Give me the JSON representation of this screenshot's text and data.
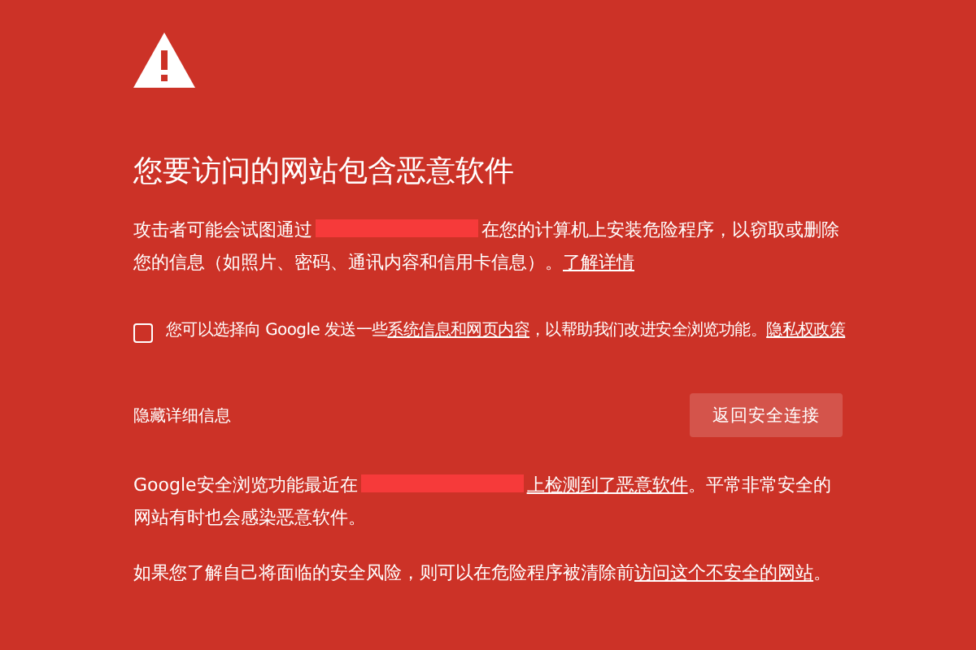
{
  "title": "您要访问的网站包含恶意软件",
  "intro": [
    {
      "kind": "text",
      "text": "攻击者可能会试图通过"
    },
    {
      "kind": "redacted"
    },
    {
      "kind": "text",
      "text": "在您的计算机上安装危险程序，以窃取或删除您的信息（如照片、密码、通讯内容和信用卡信息）。"
    },
    {
      "kind": "link",
      "text": "了解详情"
    }
  ],
  "report": {
    "checked": false,
    "parts": [
      {
        "kind": "text",
        "text": "您可以选择向 Google 发送一些"
      },
      {
        "kind": "link",
        "text": "系统信息和网页内容"
      },
      {
        "kind": "text",
        "text": "，以帮助我们改进安全浏览功能。"
      },
      {
        "kind": "link",
        "text": "隐私权政策"
      }
    ]
  },
  "details_toggle": "隐藏详细信息",
  "back_button": "返回安全连接",
  "details": [
    [
      {
        "kind": "text",
        "text": "Google安全浏览功能最近在"
      },
      {
        "kind": "redacted"
      },
      {
        "kind": "link",
        "text": "上检测到了恶意软件"
      },
      {
        "kind": "text",
        "text": "。平常非常安全的网站有时也会感染恶意软件。"
      }
    ],
    [
      {
        "kind": "text",
        "text": "如果您了解自己将面临的安全风险，则可以在危险程序被清除前"
      },
      {
        "kind": "link",
        "text": "访问这个不安全的网站"
      },
      {
        "kind": "text",
        "text": "。"
      }
    ]
  ]
}
